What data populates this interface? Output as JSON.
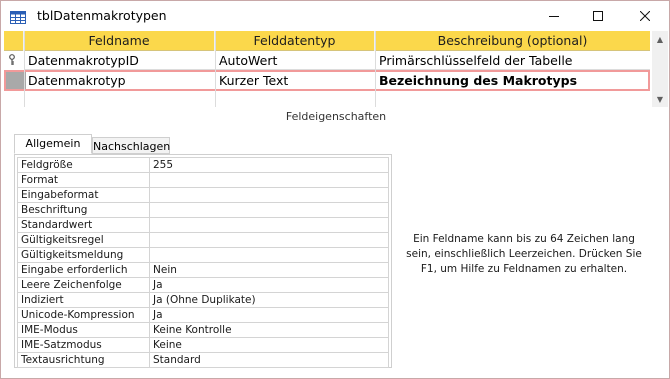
{
  "window": {
    "title": "tblDatenmakrotypen",
    "icon": "table-icon",
    "controls": {
      "minimize": "minimize-icon",
      "maximize": "maximize-icon",
      "close": "close-icon"
    }
  },
  "grid": {
    "columns": [
      "Feldname",
      "Felddatentyp",
      "Beschreibung (optional)"
    ],
    "rows": [
      {
        "name": "DatenmakrotypID",
        "type": "AutoWert",
        "description": "Primärschlüsselfeld der Tabelle",
        "primary_key": true
      },
      {
        "name": "Datenmakrotyp",
        "type": "Kurzer Text",
        "description": "Bezeichnung des Makrotyps",
        "selected": true
      },
      {
        "name": "",
        "type": "",
        "description": ""
      }
    ],
    "header_color": "#fbd84b",
    "selection_color": "#f19a9a"
  },
  "properties": {
    "title": "Feldeigenschaften",
    "tabs": [
      "Allgemein",
      "Nachschlagen"
    ],
    "active_tab": "Allgemein",
    "items": [
      {
        "key": "Feldgröße",
        "value": "255"
      },
      {
        "key": "Format",
        "value": ""
      },
      {
        "key": "Eingabeformat",
        "value": ""
      },
      {
        "key": "Beschriftung",
        "value": ""
      },
      {
        "key": "Standardwert",
        "value": ""
      },
      {
        "key": "Gültigkeitsregel",
        "value": ""
      },
      {
        "key": "Gültigkeitsmeldung",
        "value": ""
      },
      {
        "key": "Eingabe erforderlich",
        "value": "Nein"
      },
      {
        "key": "Leere Zeichenfolge",
        "value": "Ja"
      },
      {
        "key": "Indiziert",
        "value": "Ja (Ohne Duplikate)"
      },
      {
        "key": "Unicode-Kompression",
        "value": "Ja"
      },
      {
        "key": "IME-Modus",
        "value": "Keine Kontrolle"
      },
      {
        "key": "IME-Satzmodus",
        "value": "Keine"
      },
      {
        "key": "Textausrichtung",
        "value": "Standard"
      }
    ],
    "help_text": "Ein Feldname kann bis zu 64 Zeichen lang sein, einschließlich Leerzeichen. Drücken Sie F1, um Hilfe zu Feldnamen zu erhalten."
  }
}
